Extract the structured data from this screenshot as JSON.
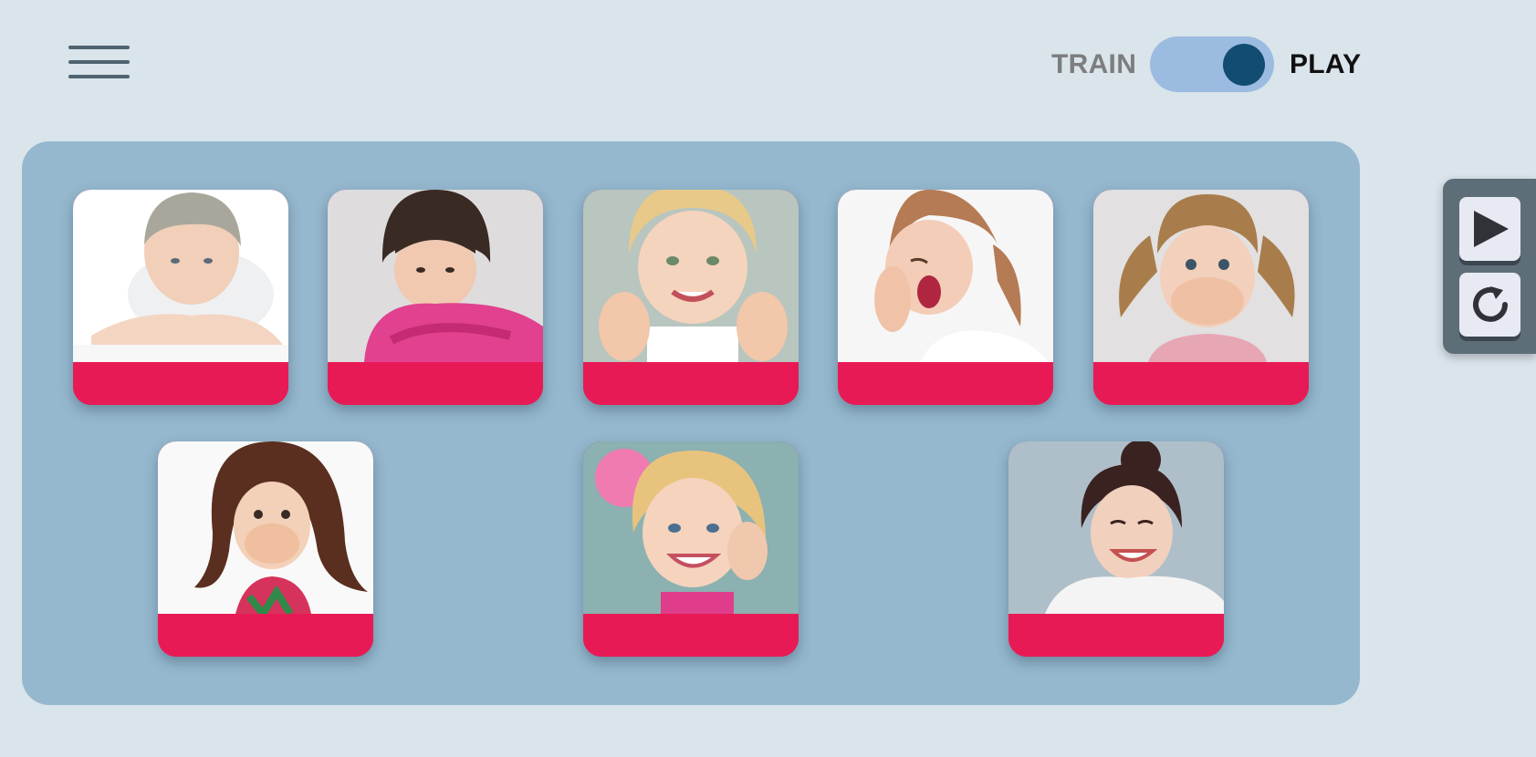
{
  "header": {
    "menu_icon": "hamburger-menu-icon",
    "mode_switch": {
      "left_label": "TRAIN",
      "right_label": "PLAY",
      "state": "play"
    }
  },
  "cards": [
    {
      "emotion_image": "sad-boy-photo",
      "caption": ""
    },
    {
      "emotion_image": "angry-girl-photo",
      "caption": ""
    },
    {
      "emotion_image": "happy-thumbs-up-girl-photo",
      "caption": ""
    },
    {
      "emotion_image": "yawning-girl-photo",
      "caption": ""
    },
    {
      "emotion_image": "surprised-girl-photo",
      "caption": ""
    },
    {
      "emotion_image": "scared-girl-photo",
      "caption": ""
    },
    {
      "emotion_image": "smiling-girl-photo",
      "caption": ""
    },
    {
      "emotion_image": "laughing-woman-photo",
      "caption": ""
    }
  ],
  "side_controls": {
    "play_icon": "play-icon",
    "repeat_icon": "repeat-icon"
  },
  "colors": {
    "page_bg": "#d9e4eb",
    "board_bg": "#95b8ce",
    "card_bar": "#e81a55",
    "switch_track": "#9bbbe0",
    "switch_knob": "#124c72",
    "panel_bg": "#5e6e79"
  }
}
